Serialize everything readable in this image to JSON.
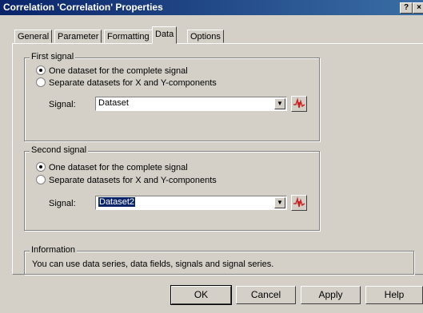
{
  "window": {
    "title": "Correlation 'Correlation' Properties",
    "help_button": "?",
    "close_button": "×"
  },
  "tabs": [
    {
      "label": "General",
      "active": false
    },
    {
      "label": "Parameter",
      "active": false
    },
    {
      "label": "Formatting",
      "active": false
    },
    {
      "label": "Data",
      "active": true
    },
    {
      "label": "Options",
      "active": false
    }
  ],
  "first_signal": {
    "title": "First signal",
    "options": [
      "One dataset for the complete signal",
      "Separate datasets for X and Y-components"
    ],
    "selected_option": 0,
    "signal_label": "Signal:",
    "signal_value": "Dataset"
  },
  "second_signal": {
    "title": "Second signal",
    "options": [
      "One dataset for the complete signal",
      "Separate datasets for X and Y-components"
    ],
    "selected_option": 0,
    "signal_label": "Signal:",
    "signal_value": "Dataset2"
  },
  "information": {
    "title": "Information",
    "text": "You can use data series, data fields, signals and signal series."
  },
  "buttons": {
    "ok": "OK",
    "cancel": "Cancel",
    "apply": "Apply",
    "help": "Help"
  },
  "colors": {
    "title_gradient_start": "#0a246a",
    "title_gradient_end": "#3a6ea5",
    "face": "#d4d0c8",
    "selection": "#0a246a",
    "picker_icon": "#cc2222"
  },
  "icons": {
    "dropdown": "chevron-down-icon",
    "signal_picker": "signal-picker-icon"
  }
}
